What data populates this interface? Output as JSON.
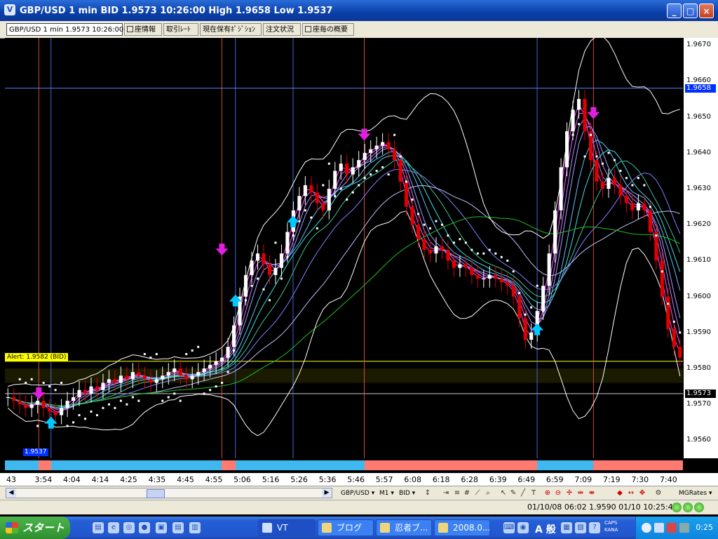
{
  "window": {
    "title": "GBP/USD 1 min BID 1.9573 10:26:00 High 1.9658 Low 1.9537",
    "controls": {
      "minimize": "_",
      "maximize": "□",
      "close": "×"
    }
  },
  "tabs": [
    {
      "label": "GBP/USD 1 min 1.9573 10:26:00",
      "active": true
    },
    {
      "label": "座情報",
      "checkbox": true
    },
    {
      "label": "取引ﾚｰﾄ"
    },
    {
      "label": "現在保有ﾎﾟｼﾞｼｮﾝ"
    },
    {
      "label": "注文状況"
    },
    {
      "label": "座毎の概要",
      "checkbox": true
    }
  ],
  "chart_data": {
    "type": "candlestick",
    "y_ticks": [
      "1.9670",
      "1.9660",
      "1.9650",
      "1.9640",
      "1.9630",
      "1.9620",
      "1.9610",
      "1.9600",
      "1.9590",
      "1.9580",
      "1.9570",
      "1.9560"
    ],
    "ylim": [
      1.9555,
      1.9672
    ],
    "x_ticks": [
      "43",
      "3:54",
      "4:04",
      "4:14",
      "4:25",
      "4:35",
      "4:45",
      "4:55",
      "5:06",
      "5:16",
      "5:26",
      "5:36",
      "5:46",
      "5:57",
      "6:08",
      "6:18",
      "6:28",
      "6:39",
      "6:49",
      "6:59",
      "7:09",
      "7:19",
      "7:30",
      "7:40"
    ],
    "high_marker": "1.9658",
    "current_marker": "1.9573",
    "low_marker": "1.9537",
    "alert_label": "Alert: 1.9582 (BID)",
    "alert_level": 1.9582,
    "closes": [
      1.9572,
      1.9571,
      1.957,
      1.9569,
      1.957,
      1.9571,
      1.9569,
      1.9568,
      1.9567,
      1.9569,
      1.9571,
      1.9572,
      1.9574,
      1.9573,
      1.9575,
      1.9574,
      1.9576,
      1.9577,
      1.9576,
      1.9578,
      1.9577,
      1.9579,
      1.9578,
      1.9577,
      1.9576,
      1.9577,
      1.9578,
      1.9579,
      1.958,
      1.9578,
      1.9577,
      1.9578,
      1.9579,
      1.958,
      1.9581,
      1.9582,
      1.9583,
      1.9586,
      1.9592,
      1.96,
      1.9606,
      1.961,
      1.9612,
      1.9609,
      1.9606,
      1.9608,
      1.9612,
      1.9618,
      1.9624,
      1.9628,
      1.9631,
      1.9629,
      1.9626,
      1.9624,
      1.963,
      1.9635,
      1.9637,
      1.9634,
      1.9636,
      1.9638,
      1.964,
      1.9641,
      1.9642,
      1.9643,
      1.9641,
      1.9638,
      1.9632,
      1.9625,
      1.962,
      1.9616,
      1.9613,
      1.9612,
      1.9614,
      1.9613,
      1.961,
      1.9608,
      1.9609,
      1.9608,
      1.9606,
      1.9605,
      1.9605,
      1.9606,
      1.9605,
      1.9604,
      1.9603,
      1.96,
      1.9594,
      1.9588,
      1.959,
      1.9596,
      1.9603,
      1.9612,
      1.9624,
      1.9636,
      1.9646,
      1.9652,
      1.9655,
      1.9646,
      1.9638,
      1.9632,
      1.963,
      1.9633,
      1.9631,
      1.9628,
      1.9626,
      1.9624,
      1.9626,
      1.9624,
      1.9618,
      1.961,
      1.96,
      1.9591,
      1.9586,
      1.9583
    ]
  },
  "time_bar": [
    "blue",
    "red",
    "blue",
    "blue",
    "red",
    "blue",
    "red"
  ],
  "toolbar": {
    "scroll_left": "◀",
    "scroll_right": "▶",
    "symbol": "GBP/USD",
    "period": "M1",
    "price_type": "BID",
    "indicator": "MGRates"
  },
  "status": {
    "text": "01/10/08 06:02  1.9590  01/10 10:25:42"
  },
  "taskbar": {
    "start_label": "スタート",
    "tasks": [
      {
        "label": "VT",
        "active": true
      },
      {
        "label": "ブログ"
      },
      {
        "label": "忍者ブ..."
      },
      {
        "label": "2008.0..."
      }
    ],
    "ime": "A 般",
    "caps": "CAPS",
    "kana": "KANA",
    "clock": "0:25"
  },
  "colors": {
    "candle_up": "#ffffff",
    "candle_down": "#e00000",
    "band": "#ffffff",
    "arrow_down": "#e020e0",
    "arrow_up": "#00c8ff",
    "alert": "#ffff00",
    "grid_h": "#5080ff"
  }
}
